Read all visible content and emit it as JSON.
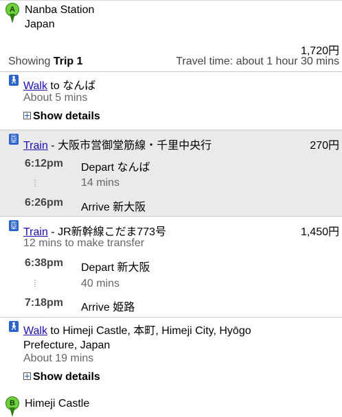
{
  "origin": {
    "marker": "A",
    "name": "Nanba Station",
    "country": "Japan"
  },
  "summary": {
    "total_fare": "1,720円",
    "showing_prefix": "Showing ",
    "trip": "Trip 1",
    "travel_time": "Travel time: about 1 hour 30 mins"
  },
  "steps": [
    {
      "mode_link": "Walk",
      "desc": " to なんば",
      "duration": "About 5 mins",
      "details": "Show details"
    },
    {
      "mode_link": "Train",
      "line": " - 大阪市営御堂筋線・千里中央行",
      "fare": "270円",
      "depart_time": "6:12pm",
      "depart_label": "Depart なんば",
      "ride_duration": "14 mins",
      "arrive_time": "6:26pm",
      "arrive_label": "Arrive 新大阪"
    },
    {
      "mode_link": "Train",
      "line": " - JR新幹線こだま773号",
      "fare": "1,450円",
      "transfer": "12 mins to make transfer",
      "depart_time": "6:38pm",
      "depart_label": "Depart 新大阪",
      "ride_duration": "40 mins",
      "arrive_time": "7:18pm",
      "arrive_label": "Arrive 姫路"
    },
    {
      "mode_link": "Walk",
      "desc_line1": " to Himeji Castle, 本町, Himeji City, Hyōgo",
      "desc_line2": "Prefecture, Japan",
      "duration": "About 19 mins",
      "details": "Show details"
    }
  ],
  "destination": {
    "marker": "B",
    "name": "Himeji Castle"
  },
  "icons": {
    "walk": "walk-icon",
    "train": "train-icon"
  },
  "colors": {
    "link": "#1a0dab",
    "marker": "#6fcf3c",
    "highlight_row": "#eaeaea"
  }
}
